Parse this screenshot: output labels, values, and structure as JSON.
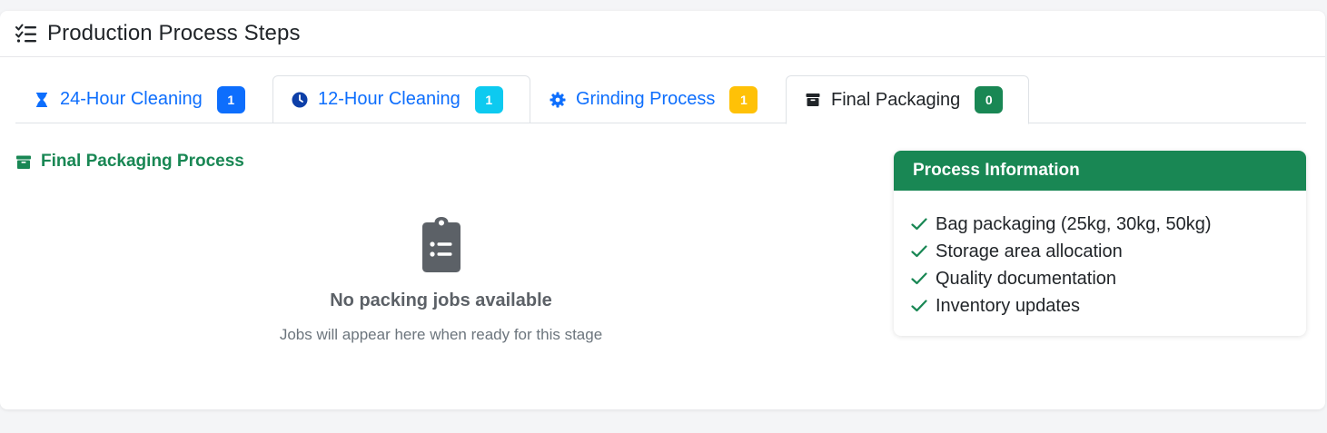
{
  "header": {
    "title": "Production Process Steps",
    "icon": "list-check-icon"
  },
  "tabs": [
    {
      "label": "24-Hour Cleaning",
      "icon": "hourglass-icon",
      "badge": "1",
      "badge_color": "#0d6efd"
    },
    {
      "label": "12-Hour Cleaning",
      "icon": "clock-icon",
      "badge": "1",
      "badge_color": "#0dcaf0"
    },
    {
      "label": "Grinding Process",
      "icon": "gear-icon",
      "badge": "1",
      "badge_color": "#ffc107"
    },
    {
      "label": "Final Packaging",
      "icon": "box-icon",
      "badge": "0",
      "badge_color": "#198754",
      "active": true
    }
  ],
  "section": {
    "title": "Final Packaging Process",
    "icon": "box-icon"
  },
  "empty_state": {
    "icon": "clipboard-list-icon",
    "title": "No packing jobs available",
    "subtitle": "Jobs will appear here when ready for this stage"
  },
  "info_card": {
    "title": "Process Information",
    "items": [
      "Bag packaging (25kg, 30kg, 50kg)",
      "Storage area allocation",
      "Quality documentation",
      "Inventory updates"
    ]
  },
  "colors": {
    "primary": "#0d6efd",
    "success": "#198754",
    "info": "#0dcaf0",
    "warning": "#ffc107"
  }
}
